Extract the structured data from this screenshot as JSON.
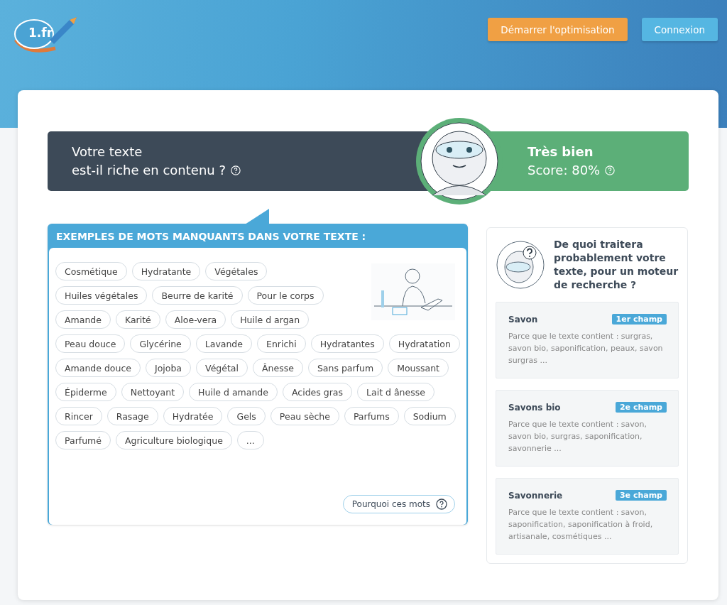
{
  "header": {
    "logo_text": "1.fr",
    "buttons": [
      {
        "label": "Démarrer l'optimisation",
        "kind": "primary"
      },
      {
        "label": "Connexion",
        "kind": "secondary"
      }
    ]
  },
  "score": {
    "question_line1": "Votre texte",
    "question_line2": "est-il riche en contenu ?",
    "verdict": "Très bien",
    "score_text": "Score: 80%"
  },
  "missing_words": {
    "title": "EXEMPLES DE MOTS MANQUANTS DANS VOTRE TEXTE :",
    "words": [
      "Cosmétique",
      "Hydratante",
      "Végétales",
      "Huiles végétales",
      "Beurre de karité",
      "Pour le corps",
      "Amande",
      "Karité",
      "Aloe-vera",
      "Huile d argan",
      "Peau douce",
      "Glycérine",
      "Lavande",
      "Enrichi",
      "Hydratantes",
      "Hydratation",
      "Amande douce",
      "Jojoba",
      "Végétal",
      "Ânesse",
      "Sans parfum",
      "Moussant",
      "Épiderme",
      "Nettoyant",
      "Huile d amande",
      "Acides gras",
      "Lait d ânesse",
      "Rincer",
      "Rasage",
      "Hydratée",
      "Gels",
      "Peau sèche",
      "Parfums",
      "Sodium",
      "Parfumé",
      "Agriculture biologique",
      "..."
    ],
    "why_button": "Pourquoi ces mots"
  },
  "topics": {
    "title": "De quoi traitera probablement votre texte, pour un moteur de recherche ?",
    "items": [
      {
        "name": "Savon",
        "rank": "1er champ",
        "reason": "Parce que le texte contient :  surgras, savon bio, saponification, peaux, savon surgras ..."
      },
      {
        "name": "Savons bio",
        "rank": "2e champ",
        "reason": "Parce que le texte contient :  savon, savon bio, surgras, saponification, savonnerie ..."
      },
      {
        "name": "Savonnerie",
        "rank": "3e champ",
        "reason": "Parce que le texte contient :  savon, saponification, saponification à froid, artisanale, cosmétiques ..."
      }
    ]
  }
}
